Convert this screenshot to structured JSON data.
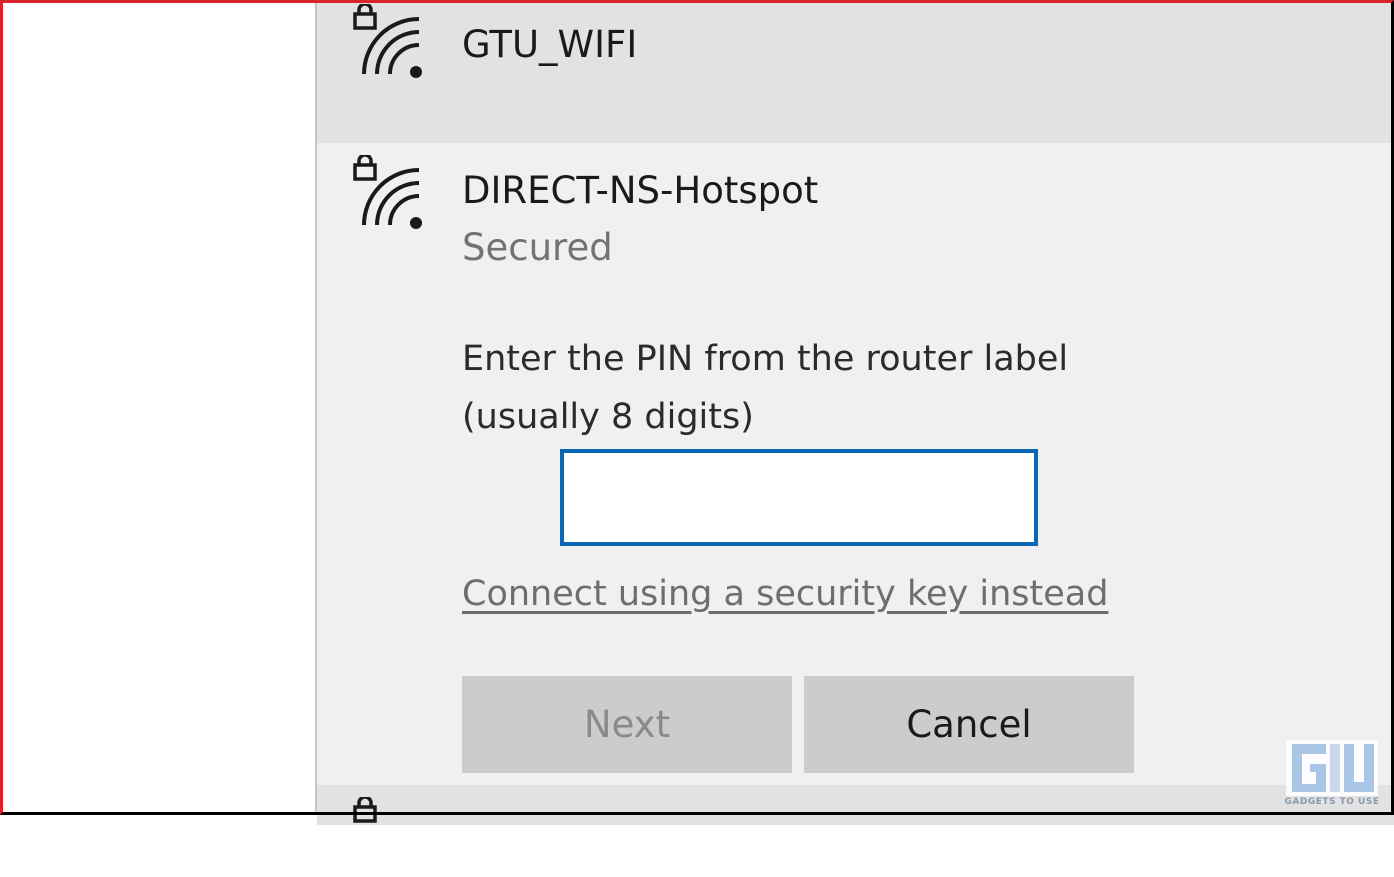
{
  "networks": [
    {
      "ssid": "GTU_WIFI",
      "icon": "wifi-secured-icon"
    },
    {
      "ssid": "DIRECT-NS-Hotspot",
      "status": "Secured",
      "icon": "wifi-secured-icon"
    },
    {
      "icon": "wifi-secured-icon"
    }
  ],
  "pin_prompt": {
    "line1": "Enter the PIN from the router label",
    "line2": "(usually 8 digits)",
    "input_value": ""
  },
  "alt_link": "Connect using a security key instead",
  "buttons": {
    "next": "Next",
    "cancel": "Cancel"
  },
  "watermark": {
    "brand_text": "GADGETS TO USE"
  },
  "colors": {
    "input_border": "#0a67b3",
    "frame_border": "#d8232f"
  }
}
